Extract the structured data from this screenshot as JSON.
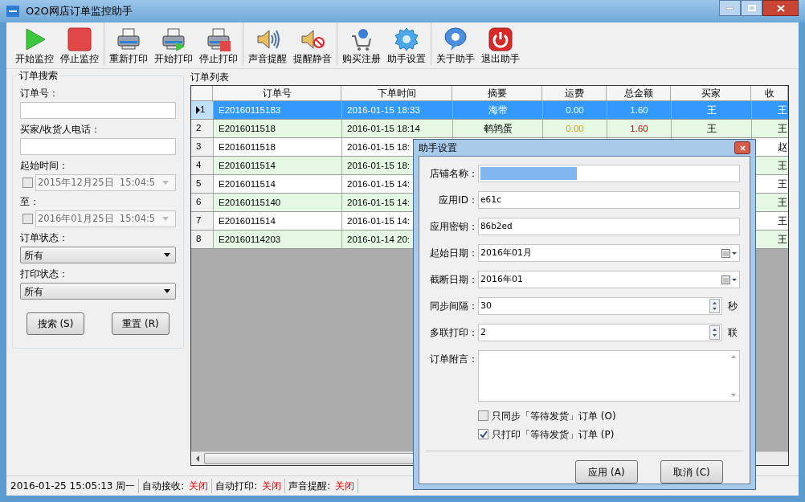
{
  "window": {
    "title": "O2O网店订单监控助手"
  },
  "toolbar": [
    [
      {
        "kind": "play",
        "label": "开始监控"
      },
      {
        "kind": "stop",
        "label": "停止监控"
      }
    ],
    [
      {
        "kind": "printer",
        "label": "重新打印"
      },
      {
        "kind": "printer-play",
        "label": "开始打印"
      },
      {
        "kind": "printer-stop",
        "label": "停止打印"
      }
    ],
    [
      {
        "kind": "sound",
        "label": "声音提醒"
      },
      {
        "kind": "mute",
        "label": "提醒静音"
      }
    ],
    [
      {
        "kind": "cart",
        "label": "购买注册"
      },
      {
        "kind": "gear",
        "label": "助手设置"
      }
    ],
    [
      {
        "kind": "about",
        "label": "关于助手"
      },
      {
        "kind": "power",
        "label": "退出助手"
      }
    ]
  ],
  "search_panel": {
    "title": "订单搜索",
    "fields": [
      {
        "kind": "text",
        "label": "订单号："
      },
      {
        "kind": "text",
        "label": "买家/收货人电话："
      },
      {
        "kind": "date",
        "label": "起始时间：",
        "checked": false,
        "value": "2015年12月25日  15:04:5"
      },
      {
        "kind": "date",
        "label": "至：",
        "checked": false,
        "value": "2016年01月25日  15:04:5"
      },
      {
        "kind": "select",
        "label": "订单状态：",
        "value": "所有"
      },
      {
        "kind": "select",
        "label": "打印状态：",
        "value": "所有"
      }
    ],
    "buttons": [
      "搜索 (S)",
      "重置 (R)"
    ]
  },
  "order_list": {
    "title": "订单列表",
    "columns": [
      "订单号",
      "下单时间",
      "摘要",
      "运费",
      "总金额",
      "买家",
      "收"
    ],
    "rows": [
      {
        "index": "1",
        "selected": true,
        "cells": [
          "E20160115183",
          "2016-01-15 18:33",
          "海带",
          "0.00",
          "1.60",
          "王",
          "王"
        ]
      },
      {
        "index": "2",
        "selected": false,
        "cells": [
          "E2016011518",
          "2016-01-15 18:14",
          "鹌鹑蛋",
          "0.00",
          "1.60",
          "王",
          "王"
        ]
      },
      {
        "index": "3",
        "selected": false,
        "cells": [
          "E2016011518",
          "2016-01-15 18:",
          null,
          null,
          null,
          null,
          "赵"
        ]
      },
      {
        "index": "4",
        "selected": false,
        "cells": [
          "E2016011514",
          "2016-01-15 18:",
          null,
          null,
          null,
          null,
          "王"
        ]
      },
      {
        "index": "5",
        "selected": false,
        "cells": [
          "E2016011514",
          "2016-01-15 14:",
          null,
          null,
          null,
          null,
          "王"
        ]
      },
      {
        "index": "6",
        "selected": false,
        "cells": [
          "E20160115140",
          "2016-01-15 14:",
          null,
          null,
          null,
          null,
          "王"
        ]
      },
      {
        "index": "7",
        "selected": false,
        "cells": [
          "E2016011514",
          "2016-01-15 14:",
          null,
          null,
          null,
          null,
          "王"
        ]
      },
      {
        "index": "8",
        "selected": false,
        "cells": [
          "E20160114203",
          "2016-01-14 20:",
          null,
          null,
          null,
          null,
          "王"
        ]
      }
    ]
  },
  "status_bar": {
    "datetime": "2016-01-25 15:05:13 周一",
    "items": [
      {
        "label": "自动接收:",
        "value": "关闭"
      },
      {
        "label": "自动打印:",
        "value": "关闭"
      },
      {
        "label": "声音提醒:",
        "value": "关闭"
      }
    ]
  },
  "dialog": {
    "title": "助手设置",
    "fields": [
      {
        "kind": "text",
        "label": "店铺名称：",
        "selected_text": true
      },
      {
        "kind": "text",
        "label": "应用ID：",
        "value": "e61c"
      },
      {
        "kind": "text",
        "label": "应用密钥：",
        "value": "86b2ed"
      },
      {
        "kind": "date",
        "label": "起始日期：",
        "value": "2016年01月"
      },
      {
        "kind": "date",
        "label": "截断日期：",
        "value": "2016年01"
      },
      {
        "kind": "spin",
        "label": "同步间隔：",
        "value": "30",
        "unit": "秒"
      },
      {
        "kind": "spin",
        "label": "多联打印：",
        "value": "2",
        "unit": "联"
      },
      {
        "kind": "memo",
        "label": "订单附言："
      }
    ],
    "options": [
      {
        "label": "只同步「等待发货」订单 (O)",
        "checked": false
      },
      {
        "label": "只打印「等待发货」订单 (P)",
        "checked": true
      }
    ],
    "buttons": [
      "应用 (A)",
      "取消 (C)"
    ]
  }
}
